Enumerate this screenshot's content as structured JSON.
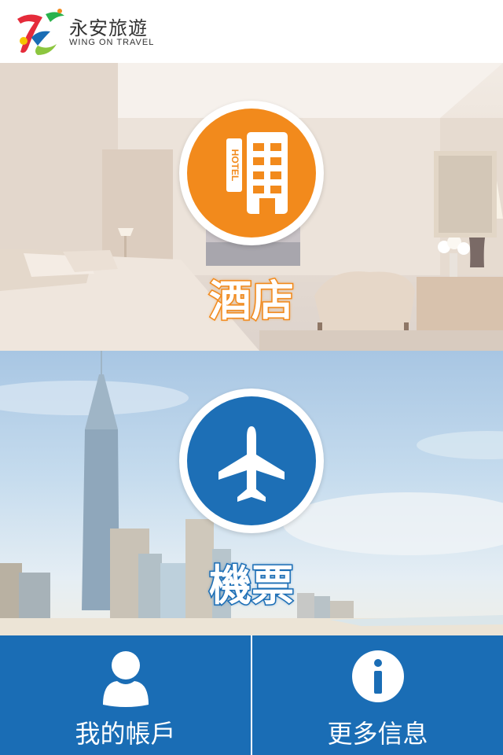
{
  "brand": {
    "name_cn": "永安旅遊",
    "name_en": "WING ON TRAVEL"
  },
  "sections": {
    "hotel": {
      "label": "酒店",
      "icon": "hotel-building-icon",
      "badge_text": "HOTEL",
      "color": "#f28a1c"
    },
    "flight": {
      "label": "機票",
      "icon": "airplane-icon",
      "color": "#1d6fb6"
    }
  },
  "bottom_bar": {
    "account_label": "我的帳戶",
    "account_icon": "user-icon",
    "more_label": "更多信息",
    "more_icon": "info-icon",
    "color": "#1a6db5"
  }
}
